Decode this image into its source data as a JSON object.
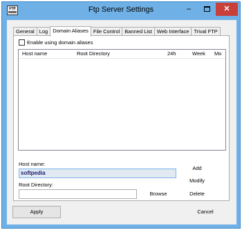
{
  "window": {
    "title": "Ftp Server Settings",
    "icon_label": "FTP",
    "minimize_glyph": "–",
    "close_glyph": "✕"
  },
  "tabs": [
    {
      "label": "General",
      "active": false
    },
    {
      "label": "Log",
      "active": false
    },
    {
      "label": "Domain Aliases",
      "active": true
    },
    {
      "label": "File Control",
      "active": false
    },
    {
      "label": "Banned List",
      "active": false
    },
    {
      "label": "Web Interface",
      "active": false
    },
    {
      "label": "Trival FTP",
      "active": false
    }
  ],
  "domain_aliases": {
    "enable_label": "Enable using domain aliases",
    "enable_checked": false,
    "columns": [
      "Host name",
      "Root Directory",
      "24h",
      "Week",
      "Mo"
    ],
    "rows": [],
    "host_name_label": "Host name:",
    "host_name_value": "softpedia",
    "root_dir_label": "Root Directory:",
    "root_dir_value": "",
    "buttons": {
      "add": "Add",
      "modify": "Modify",
      "browse": "Browse",
      "delete": "Delete"
    }
  },
  "footer": {
    "apply": "Apply",
    "cancel": "Cancel"
  },
  "colors": {
    "titlebar": "#6fb1e6",
    "close_button": "#c9403a",
    "host_selection": "#e1eaf3"
  }
}
